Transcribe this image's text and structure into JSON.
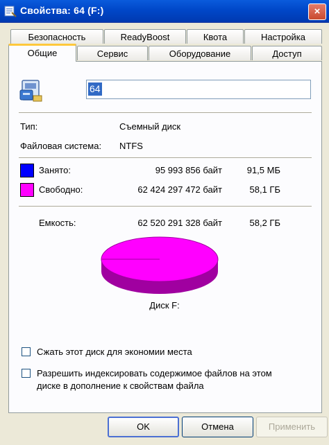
{
  "window": {
    "title": "Свойства: 64 (F:)",
    "close_symbol": "×",
    "icon": "properties-icon"
  },
  "tabs_back": [
    "Безопасность",
    "ReadyBoost",
    "Квота",
    "Настройка"
  ],
  "tabs_front": [
    "Общие",
    "Сервис",
    "Оборудование",
    "Доступ"
  ],
  "active_tab": "Общие",
  "volume": {
    "icon": "removable-drive-icon",
    "name": "64",
    "type_label": "Тип:",
    "type_value": "Съемный диск",
    "fs_label": "Файловая система:",
    "fs_value": "NTFS"
  },
  "usage": {
    "used": {
      "label": "Занято:",
      "bytes": "95 993 856 байт",
      "size": "91,5 МБ",
      "color": "#0000ff"
    },
    "free": {
      "label": "Свободно:",
      "bytes": "62 424 297 472 байт",
      "size": "58,1 ГБ",
      "color": "#ff00ff"
    },
    "capacity": {
      "label": "Емкость:",
      "bytes": "62 520 291 328 байт",
      "size": "58,2 ГБ"
    },
    "used_fraction": 0.0015,
    "disk_label": "Диск F:"
  },
  "options": {
    "compress": "Сжать этот диск для экономии места",
    "index_line1": "Разрешить индексировать содержимое файлов на этом",
    "index_line2": "диске в дополнение к свойствам файла",
    "compress_checked": false,
    "index_checked": false
  },
  "buttons": {
    "ok": "OK",
    "cancel": "Отмена",
    "apply": "Применить"
  }
}
